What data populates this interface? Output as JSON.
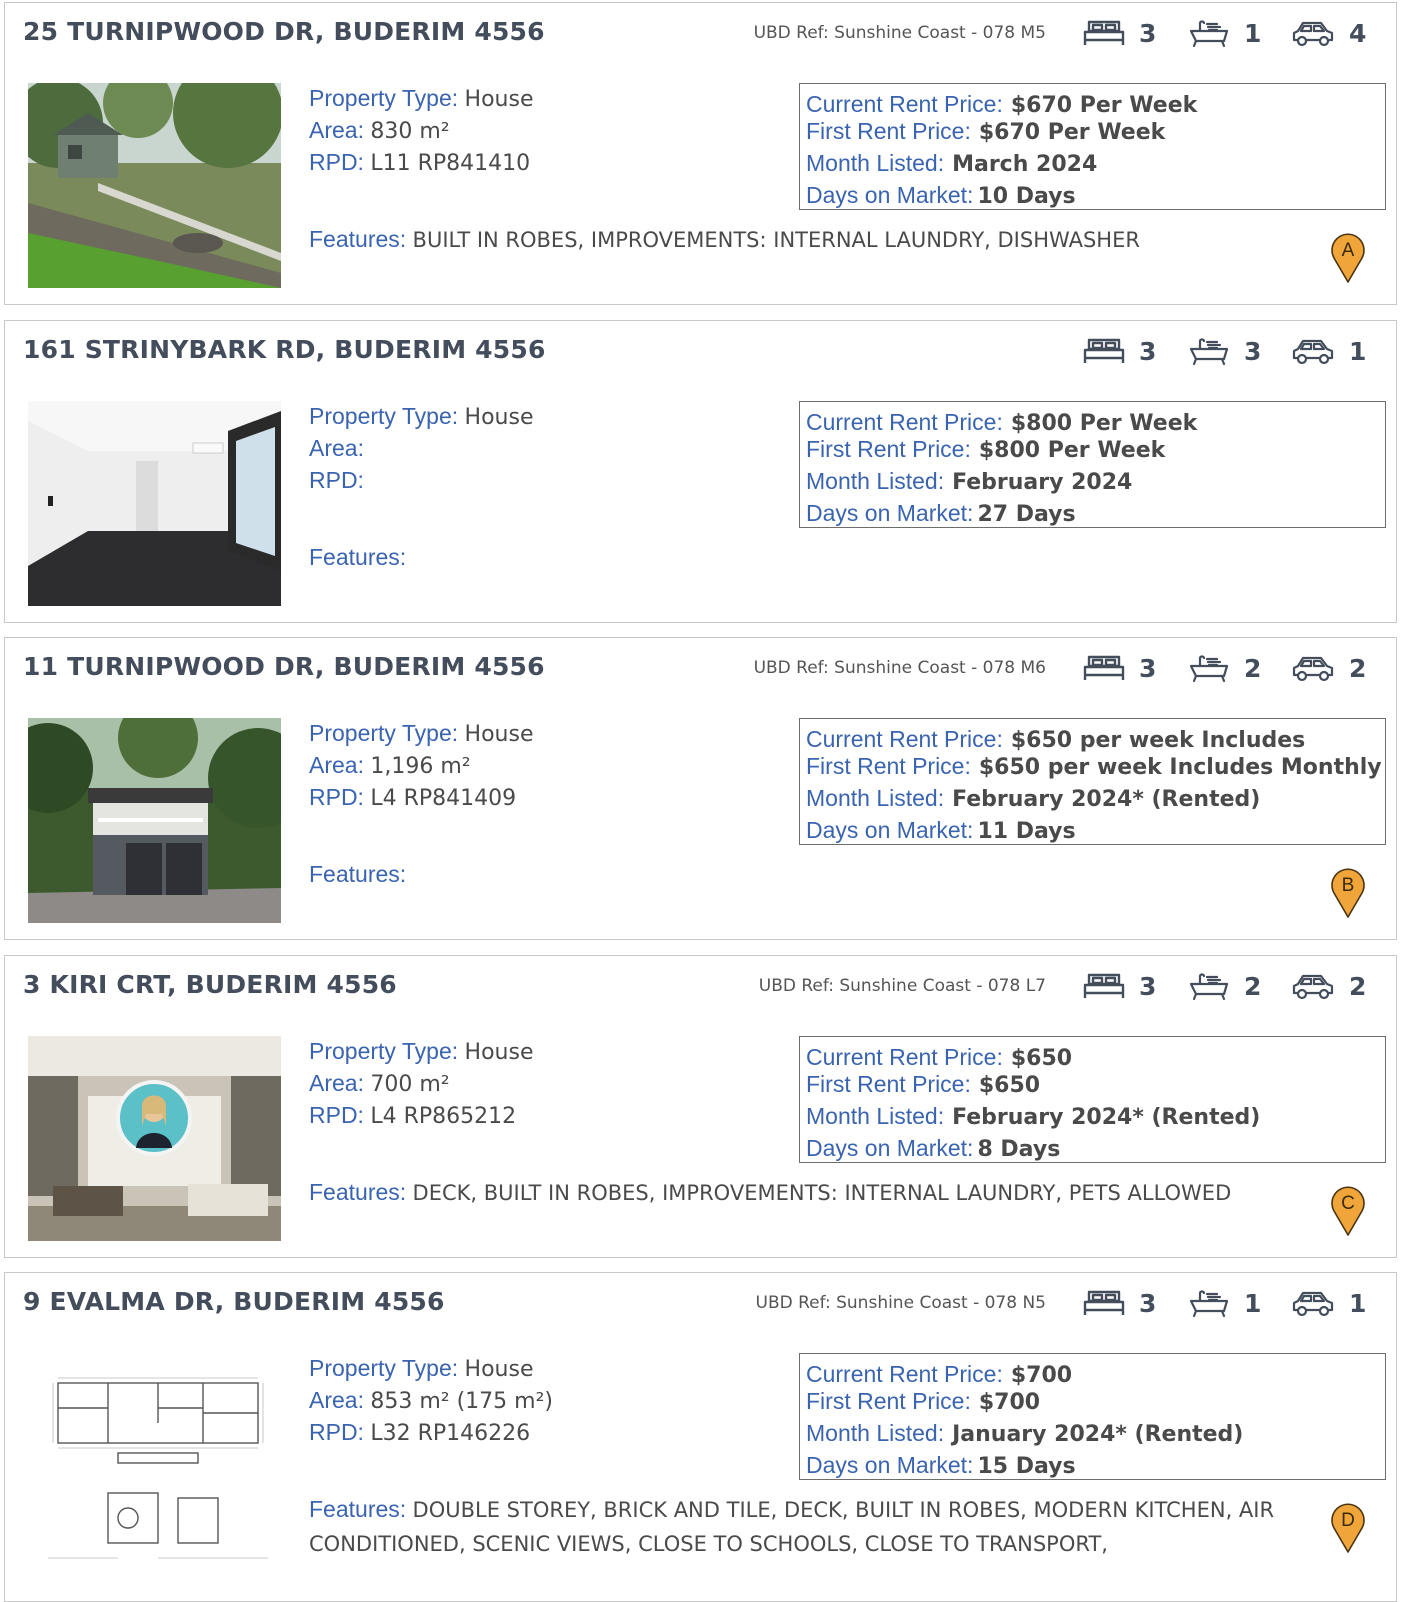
{
  "labels": {
    "property_type": "Property Type:",
    "area": "Area:",
    "rpd": "RPD:",
    "features": "Features:",
    "current_rent": "Current Rent Price:",
    "first_rent": "First Rent Price:",
    "month_listed": "Month Listed:",
    "days_on_market": "Days on Market:"
  },
  "colors": {
    "label_blue": "#3a64b0",
    "heading": "#444d5c",
    "pin": "#f0a53a"
  },
  "listings": [
    {
      "address": "25 TURNIPWOOD DR, BUDERIM 4556",
      "ubd_ref": "UBD Ref: Sunshine Coast  - 078  M5",
      "beds": "3",
      "baths": "1",
      "cars": "4",
      "photo_icon": "house-photo-hillside",
      "property_type": "House",
      "area": "830 m²",
      "rpd": "L11 RP841410",
      "features": "BUILT IN ROBES, IMPROVEMENTS: INTERNAL LAUNDRY, DISHWASHER",
      "current_rent": "$670 Per Week",
      "first_rent": "$670 Per Week",
      "month_listed": "March 2024",
      "days_on_market": "10 Days",
      "pin": "A"
    },
    {
      "address": "161 STRINYBARK RD, BUDERIM 4556",
      "ubd_ref": "",
      "beds": "3",
      "baths": "3",
      "cars": "1",
      "photo_icon": "interior-photo-room",
      "property_type": "House",
      "area": "",
      "rpd": "",
      "features": "",
      "current_rent": "$800 Per Week",
      "first_rent": "$800 Per Week",
      "month_listed": "February 2024",
      "days_on_market": "27 Days",
      "pin": ""
    },
    {
      "address": "11 TURNIPWOOD DR, BUDERIM 4556",
      "ubd_ref": "UBD Ref: Sunshine Coast  - 078  M6",
      "beds": "3",
      "baths": "2",
      "cars": "2",
      "photo_icon": "house-photo-forest",
      "property_type": "House",
      "area": "1,196 m²",
      "rpd": "L4 RP841409",
      "features": "",
      "current_rent": "$650 per week Includes",
      "first_rent": "$650 per week Includes Monthly",
      "month_listed": "February 2024* (Rented)",
      "days_on_market": "11 Days",
      "pin": "B"
    },
    {
      "address": "3 KIRI CRT, BUDERIM 4556",
      "ubd_ref": "UBD Ref: Sunshine Coast  - 078  L7",
      "beds": "3",
      "baths": "2",
      "cars": "2",
      "photo_icon": "interior-photo-agent",
      "property_type": "House",
      "area": "700 m²",
      "rpd": "L4 RP865212",
      "features": "DECK, BUILT IN ROBES, IMPROVEMENTS: INTERNAL LAUNDRY, PETS ALLOWED",
      "current_rent": "$650",
      "first_rent": "$650",
      "month_listed": "February 2024* (Rented)",
      "days_on_market": "8 Days",
      "pin": "C"
    },
    {
      "address": "9 EVALMA DR, BUDERIM 4556",
      "ubd_ref": "UBD Ref: Sunshine Coast  - 078  N5",
      "beds": "3",
      "baths": "1",
      "cars": "1",
      "photo_icon": "floor-plan",
      "property_type": "House",
      "area": "853 m² (175 m²)",
      "rpd": "L32 RP146226",
      "features": "DOUBLE STOREY, BRICK AND TILE, DECK, BUILT IN ROBES, MODERN KITCHEN, AIR CONDITIONED, SCENIC VIEWS, CLOSE TO SCHOOLS, CLOSE TO TRANSPORT,",
      "current_rent": "$700",
      "first_rent": "$700",
      "month_listed": "January 2024* (Rented)",
      "days_on_market": "15 Days",
      "pin": "D"
    }
  ]
}
